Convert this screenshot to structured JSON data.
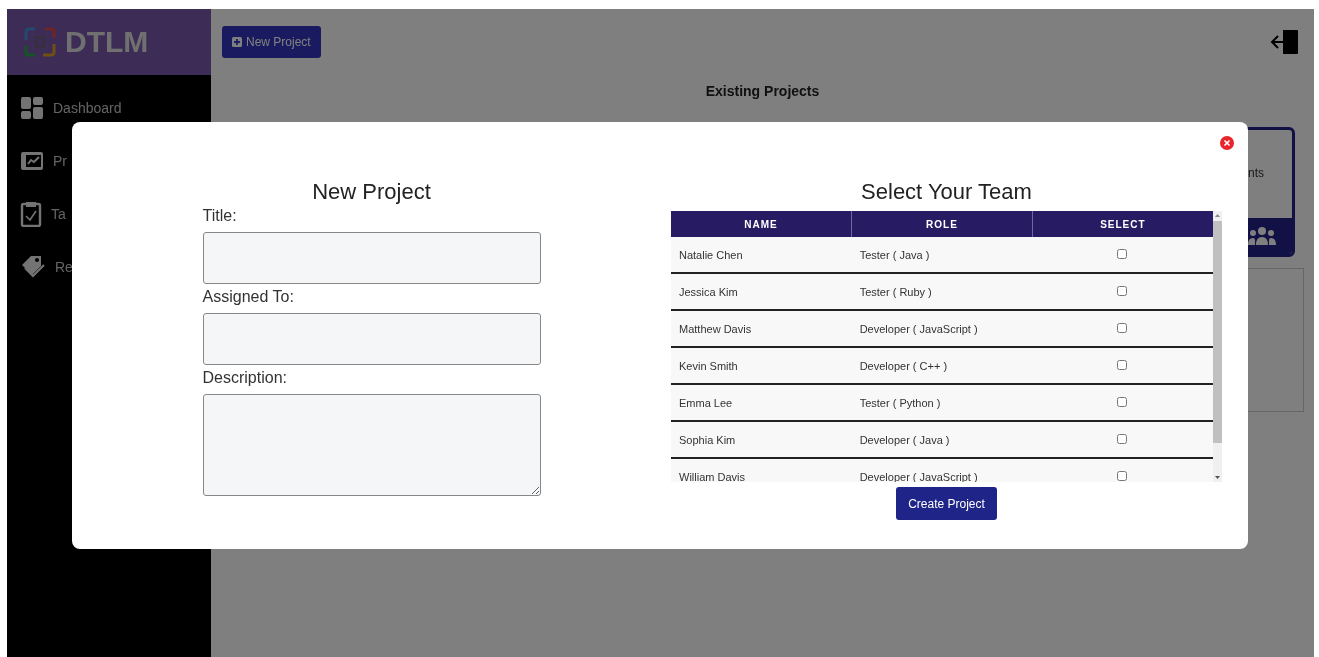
{
  "app": {
    "logo": "DTLM"
  },
  "sidebar": {
    "items": [
      {
        "label": "Dashboard",
        "kind": "grid"
      },
      {
        "label": "Pr",
        "kind": "chart"
      },
      {
        "label": "Ta",
        "kind": "clipboard"
      },
      {
        "label": "Re",
        "kind": "tags"
      }
    ]
  },
  "toolbar": {
    "new_project_button": "New Project"
  },
  "page": {
    "heading": "Existing Projects",
    "card": {
      "label": "nts"
    }
  },
  "modal": {
    "form": {
      "title": "New Project",
      "fields": [
        {
          "label": "Title:",
          "kind": "input"
        },
        {
          "label": "Assigned To:",
          "kind": "input"
        },
        {
          "label": "Description:",
          "kind": "textarea"
        }
      ]
    },
    "team": {
      "title": "Select Your Team",
      "columns": [
        "NAME",
        "ROLE",
        "SELECT"
      ],
      "rows": [
        {
          "name": "Natalie Chen",
          "role": "Tester ( Java )",
          "checked": false
        },
        {
          "name": "Jessica Kim",
          "role": "Tester ( Ruby )",
          "checked": false
        },
        {
          "name": "Matthew Davis",
          "role": "Developer ( JavaScript )",
          "checked": false
        },
        {
          "name": "Kevin Smith",
          "role": "Developer ( C++ )",
          "checked": false
        },
        {
          "name": "Emma Lee",
          "role": "Tester ( Python )",
          "checked": false
        },
        {
          "name": "Sophia Kim",
          "role": "Developer ( Java )",
          "checked": false
        },
        {
          "name": "William Davis",
          "role": "Developer ( JavaScript )",
          "checked": false
        }
      ]
    },
    "submit": "Create Project"
  }
}
